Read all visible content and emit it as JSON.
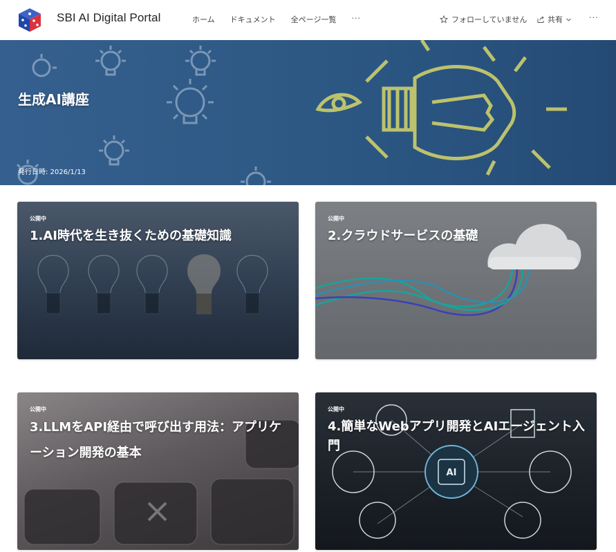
{
  "header": {
    "site_title": "SBI AI Digital Portal",
    "nav": [
      "ホーム",
      "ドキュメント",
      "全ページ一覧"
    ],
    "nav_more": "···",
    "follow_label": "フォローしていません",
    "share_label": "共有",
    "more": "···"
  },
  "hero": {
    "title": "生成AI講座",
    "date": "発行日時: 2026/1/13"
  },
  "cards": [
    {
      "badge": "公開中",
      "title": "1.AI時代を生き抜くための基礎知識"
    },
    {
      "badge": "公開中",
      "title": "2.クラウドサービスの基礎"
    },
    {
      "badge": "公開中",
      "title": "3.LLMをAPI経由で呼び出す用法：アプリケーション開発の基本"
    },
    {
      "badge": "公開中",
      "title": "4.簡単なWebアプリ開発とAIエージェント入門"
    }
  ],
  "colors": {
    "hero_blue": "#2f5a86",
    "bulb_yellow": "#d6d66a",
    "wire_teal": "#1aa39a",
    "wire_blue": "#3a3fb8"
  }
}
